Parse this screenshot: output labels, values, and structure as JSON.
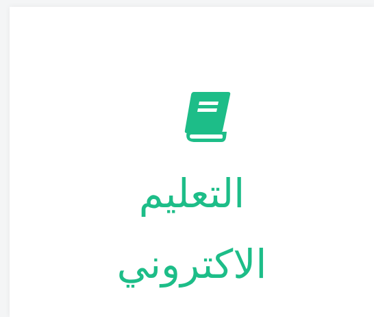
{
  "card": {
    "icon": "book-icon",
    "title_line1": "التعليم",
    "title_line2": "الاكتروني"
  },
  "colors": {
    "accent": "#1dbd88",
    "card_bg": "#ffffff",
    "page_bg": "#f4f5f6"
  }
}
